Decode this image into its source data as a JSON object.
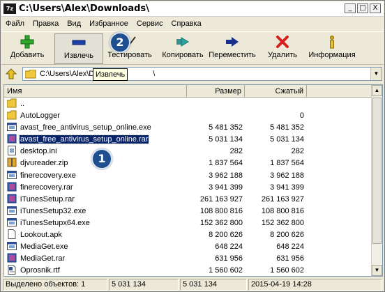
{
  "window": {
    "title": "C:\\Users\\Alex\\Downloads\\",
    "app_icon": "7z",
    "controls": [
      "minimize",
      "maximize",
      "close"
    ],
    "control_glyphs": {
      "minimize": "_",
      "maximize": "□",
      "close": "X"
    }
  },
  "menu": [
    "Файл",
    "Правка",
    "Вид",
    "Избранное",
    "Сервис",
    "Справка"
  ],
  "toolbar": [
    {
      "label": "Добавить",
      "icon": "plus-icon"
    },
    {
      "label": "Извлечь",
      "icon": "minus-icon"
    },
    {
      "label": "Тестировать",
      "icon": "check-icon"
    },
    {
      "label": "Копировать",
      "icon": "copy-arrow-icon"
    },
    {
      "label": "Переместить",
      "icon": "move-arrow-icon"
    },
    {
      "label": "Удалить",
      "icon": "delete-x-icon"
    },
    {
      "label": "Информация",
      "icon": "info-icon"
    }
  ],
  "annotations": {
    "badge1": "1",
    "badge2": "2"
  },
  "address": {
    "path": "C:\\Users\\Alex\\D",
    "path_tail": "\\",
    "tooltip": "Извлечь"
  },
  "columns": {
    "name": "Имя",
    "size": "Размер",
    "packed": "Сжатый"
  },
  "files": [
    {
      "name": "..",
      "size": "",
      "packed": "",
      "icon": "folder-up-icon"
    },
    {
      "name": "AutoLogger",
      "size": "",
      "packed": "0",
      "icon": "folder-icon"
    },
    {
      "name": "avast_free_antivirus_setup_online.exe",
      "size": "5 481 352",
      "packed": "5 481 352",
      "icon": "exe-icon"
    },
    {
      "name": "avast_free_antivirus_setup_online.rar",
      "size": "5 031 134",
      "packed": "5 031 134",
      "icon": "rar-icon",
      "selected": true
    },
    {
      "name": "desktop.ini",
      "size": "282",
      "packed": "282",
      "icon": "ini-icon"
    },
    {
      "name": "djvureader.zip",
      "size": "1 837 564",
      "packed": "1 837 564",
      "icon": "zip-icon"
    },
    {
      "name": "finerecovery.exe",
      "size": "3 962 188",
      "packed": "3 962 188",
      "icon": "exe-icon"
    },
    {
      "name": "finerecovery.rar",
      "size": "3 941 399",
      "packed": "3 941 399",
      "icon": "rar-icon"
    },
    {
      "name": "iTunesSetup.rar",
      "size": "261 163 927",
      "packed": "261 163 927",
      "icon": "rar-icon"
    },
    {
      "name": "iTunesSetup32.exe",
      "size": "108 800 816",
      "packed": "108 800 816",
      "icon": "exe-icon"
    },
    {
      "name": "iTunesSetupx64.exe",
      "size": "152 362 800",
      "packed": "152 362 800",
      "icon": "exe-icon"
    },
    {
      "name": "Lookout.apk",
      "size": "8 200 626",
      "packed": "8 200 626",
      "icon": "file-icon"
    },
    {
      "name": "MediaGet.exe",
      "size": "648 224",
      "packed": "648 224",
      "icon": "exe-icon"
    },
    {
      "name": "MediaGet.rar",
      "size": "631 956",
      "packed": "631 956",
      "icon": "rar-icon"
    },
    {
      "name": "Oprosnik.rtf",
      "size": "1 560 602",
      "packed": "1 560 602",
      "icon": "rtf-icon"
    }
  ],
  "status": {
    "selected": "Выделено объектов: 1",
    "size": "5 031 134",
    "packed": "5 031 134",
    "modified": "2015-04-19 14:28"
  },
  "scroll_glyphs": {
    "up": "▲",
    "down": "▼"
  },
  "colors": {
    "selection": "#0a246a",
    "badge": "#1f4f8f",
    "window": "#ece9d8"
  }
}
